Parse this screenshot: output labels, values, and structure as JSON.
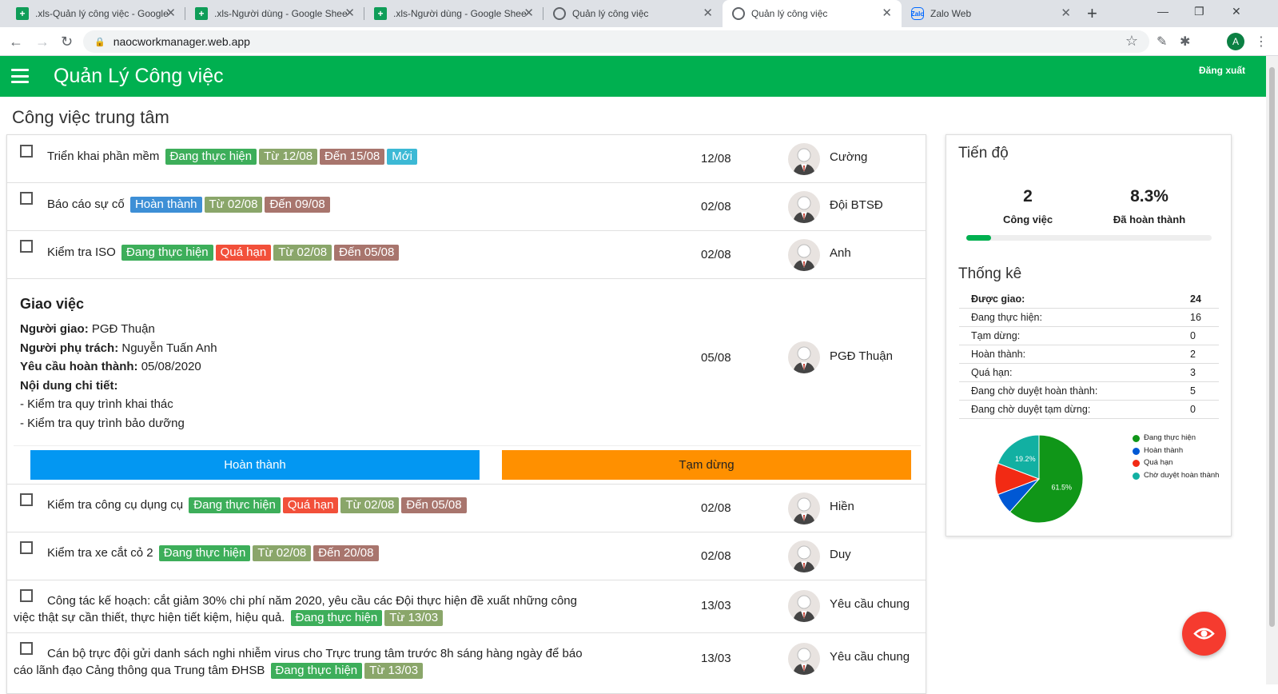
{
  "browser": {
    "tabs": [
      {
        "title": ".xls-Quản lý công việc - Google",
        "icon": "sheets-icon"
      },
      {
        "title": ".xls-Người dùng - Google Shee",
        "icon": "sheets-icon"
      },
      {
        "title": ".xls-Người dùng - Google Shee",
        "icon": "sheets-icon"
      },
      {
        "title": "Quản lý công việc",
        "icon": "globe-icon"
      },
      {
        "title": "Quản lý công việc",
        "icon": "globe-icon"
      },
      {
        "title": "Zalo Web",
        "icon": "zalo-icon"
      }
    ],
    "zalo_favicon_text": "Zalo",
    "url": "naocworkmanager.web.app",
    "profile_initial": "A"
  },
  "app": {
    "title": "Quản Lý Công việc",
    "logout": "Đăng xuất",
    "brand_color": "#00b050"
  },
  "page_title": "Công việc trung tâm",
  "tasks": [
    {
      "title": "Triển khai phần mềm",
      "badges": [
        "Đang thực hiện",
        "Từ 12/08",
        "Đến 15/08",
        "Mới"
      ],
      "date": "12/08",
      "person": "Cường"
    },
    {
      "title": "Báo cáo sự cố",
      "badges": [
        "Hoàn thành",
        "Từ 02/08",
        "Đến 09/08"
      ],
      "date": "02/08",
      "person": "Đội BTSĐ"
    },
    {
      "title": "Kiểm tra ISO",
      "badges": [
        "Đang thực hiện",
        "Quá hạn",
        "Từ 02/08",
        "Đến 05/08"
      ],
      "date": "02/08",
      "person": "Anh"
    },
    {
      "title": "Kiểm tra công cụ dụng cụ",
      "badges": [
        "Đang thực hiện",
        "Quá hạn",
        "Từ 02/08",
        "Đến 05/08"
      ],
      "date": "02/08",
      "person": "Hiền"
    },
    {
      "title": "Kiểm tra xe cắt cỏ 2",
      "badges": [
        "Đang thực hiện",
        "Từ 02/08",
        "Đến 20/08"
      ],
      "date": "02/08",
      "person": "Duy"
    },
    {
      "title_line1": "Công tác kế hoạch: cắt giảm 30% chi phí năm 2020, yêu cầu các Đội thực hiện đề xuất những công",
      "title_line2": "việc thật sự cần thiết, thực hiện tiết kiệm, hiệu quả.",
      "badges": [
        "Đang thực hiện",
        "Từ 13/03"
      ],
      "date": "13/03",
      "person": "Yêu cầu chung"
    },
    {
      "title_line1": "Cán bộ trực đội gửi danh sách nghi nhiễm virus cho Trực trung tâm trước 8h sáng hàng ngày để báo",
      "title_line2": "cáo lãnh đạo Cảng thông qua Trung tâm ĐHSB",
      "badges": [
        "Đang thực hiện",
        "Từ 13/03"
      ],
      "date": "13/03",
      "person": "Yêu cầu chung"
    }
  ],
  "detail": {
    "heading": "Giao việc",
    "assigner_label": "Người giao:",
    "assigner": "PGĐ Thuận",
    "owner_label": "Người phụ trách:",
    "owner": "Nguyễn Tuấn Anh",
    "deadline_label": "Yêu cầu hoàn thành:",
    "deadline": "05/08/2020",
    "content_label": "Nội dung chi tiết:",
    "content_lines": [
      "- Kiểm tra quy trình khai thác",
      "- Kiểm tra quy trình bảo dưỡng"
    ],
    "date": "05/08",
    "person": "PGĐ Thuận",
    "btn_done": "Hoàn thành",
    "btn_pause": "Tạm dừng"
  },
  "progress": {
    "heading": "Tiến độ",
    "count": "2",
    "count_label": "Công việc",
    "percent": "8.3%",
    "percent_label": "Đã hoàn thành",
    "fill_fraction": 0.1
  },
  "stats": {
    "heading": "Thống kê",
    "rows": [
      {
        "k": "Được giao:",
        "v": "24"
      },
      {
        "k": "Đang thực hiện:",
        "v": "16"
      },
      {
        "k": "Tạm dừng:",
        "v": "0"
      },
      {
        "k": "Hoàn thành:",
        "v": "2"
      },
      {
        "k": "Quá hạn:",
        "v": "3"
      },
      {
        "k": "Đang chờ duyệt hoàn thành:",
        "v": "5"
      },
      {
        "k": "Đang chờ duyệt tạm dừng:",
        "v": "0"
      }
    ]
  },
  "chart_data": {
    "type": "pie",
    "categories": [
      "Đang thực hiện",
      "Hoàn thành",
      "Quá hạn",
      "Chờ duyệt hoàn thành"
    ],
    "values": [
      16,
      2,
      3,
      5
    ],
    "labels": [
      "61.5%",
      "",
      "",
      "19.2%"
    ],
    "colors": [
      "#109618",
      "#0058d4",
      "#f22a14",
      "#12b0a2"
    ],
    "legend": "right"
  }
}
